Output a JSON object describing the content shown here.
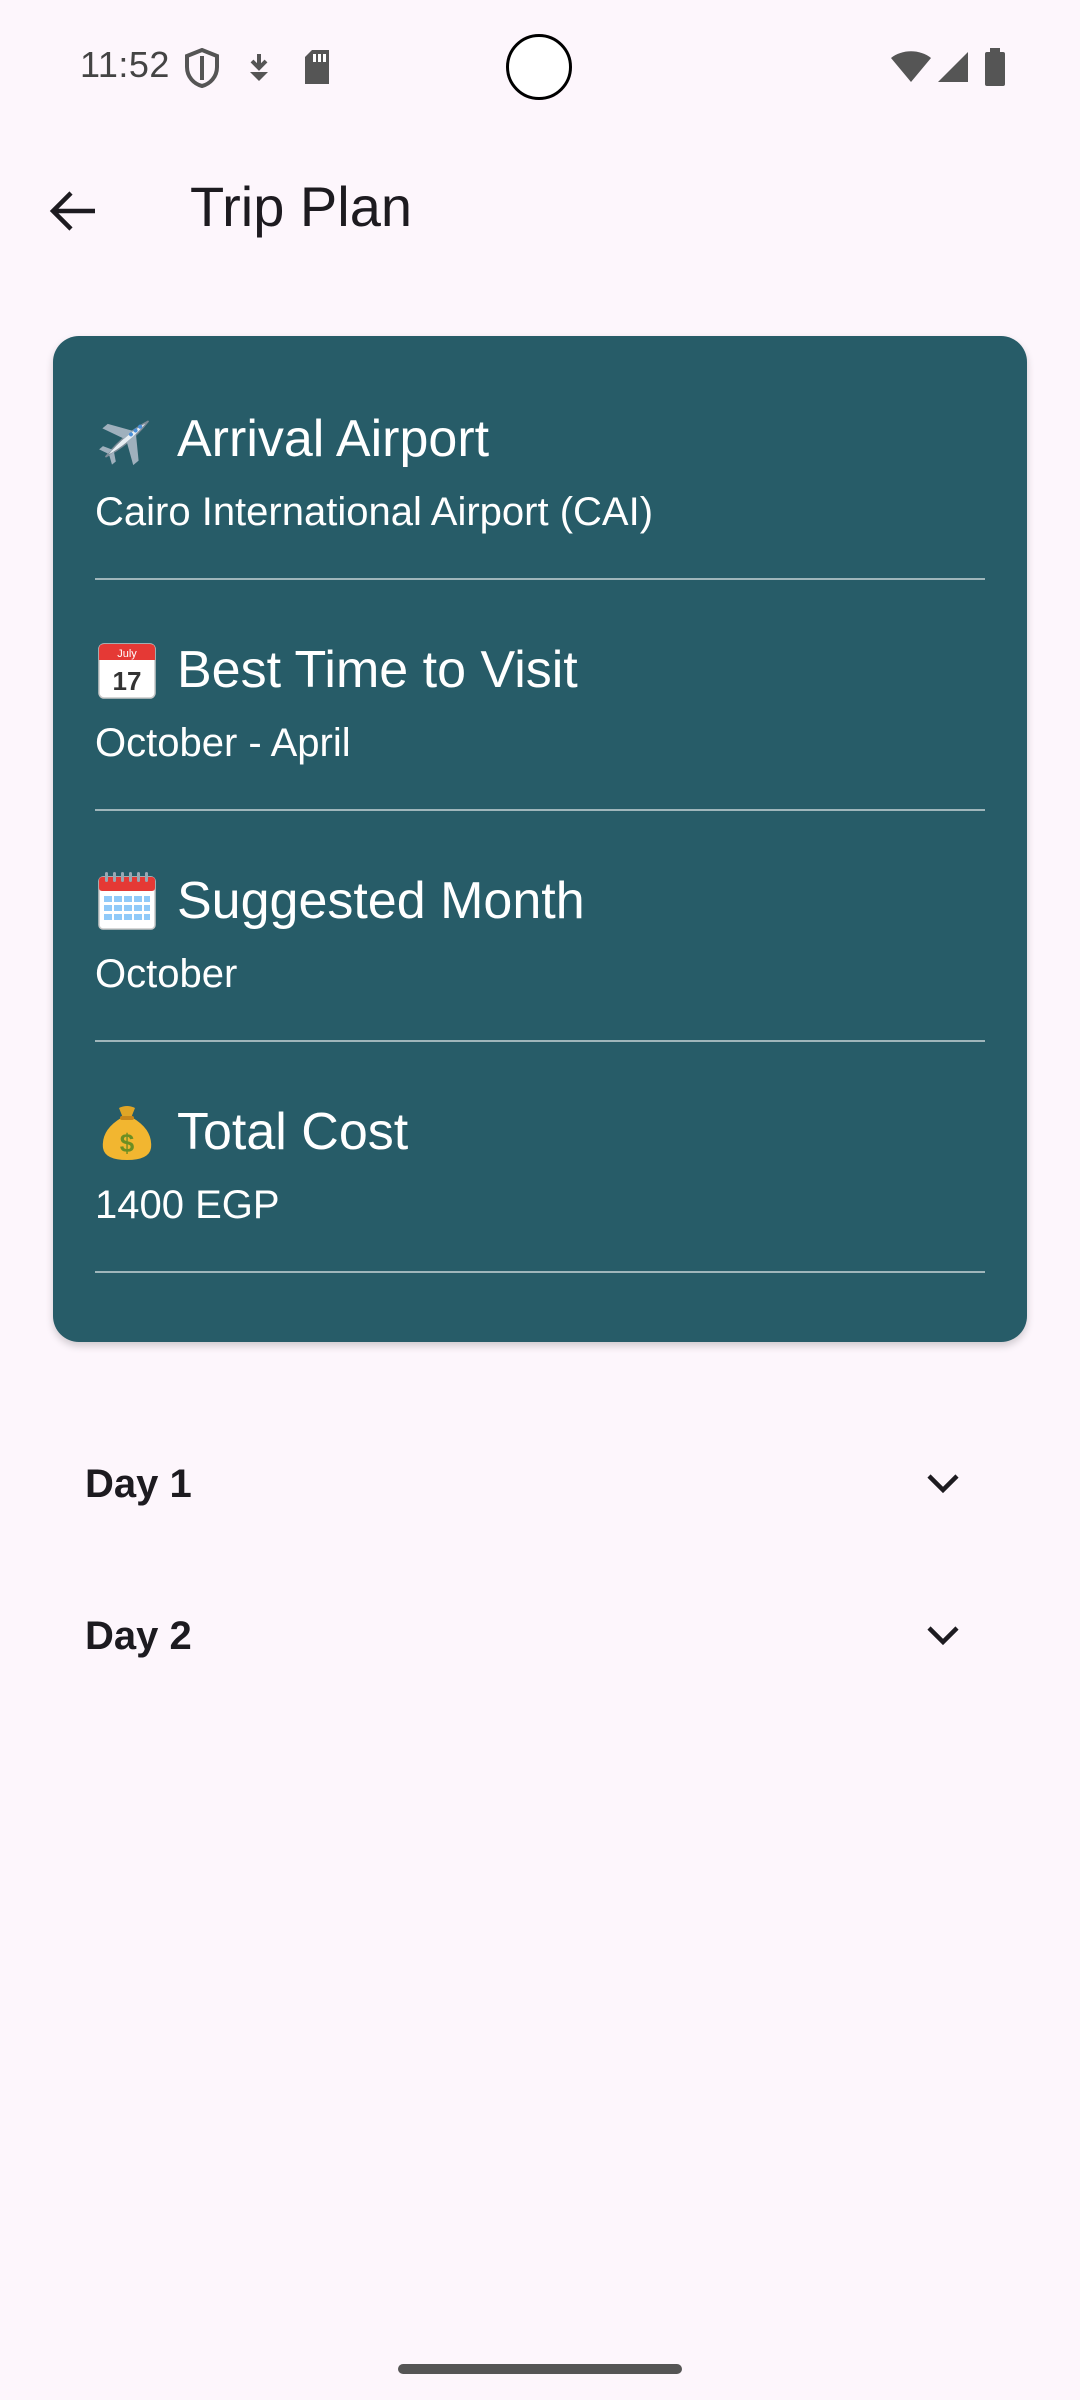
{
  "status_bar": {
    "time": "11:52",
    "icons": [
      "shield-icon",
      "download-status-icon",
      "sd-card-icon",
      "wifi-icon",
      "signal-icon",
      "battery-icon"
    ]
  },
  "app_bar": {
    "title": "Trip Plan",
    "back_icon": "arrow-back-icon"
  },
  "colors": {
    "background": "#fdf6fc",
    "card": "#275c68",
    "card_text": "#ffffff",
    "divider": "#9fb6bb"
  },
  "trip_info": [
    {
      "icon": "airplane-icon",
      "heading": "Arrival Airport",
      "value": "Cairo International Airport (CAI)"
    },
    {
      "icon": "calendar-icon",
      "calendar_month": "July",
      "calendar_day": "17",
      "heading": "Best Time to Visit",
      "value": "October - April"
    },
    {
      "icon": "spiral-calendar-icon",
      "heading": "Suggested Month",
      "value": "October"
    },
    {
      "icon": "money-bag-icon",
      "money_symbol": "$",
      "heading": "Total Cost",
      "value": "1400 EGP"
    }
  ],
  "days": [
    {
      "label": "Day 1",
      "icon": "chevron-down-icon"
    },
    {
      "label": "Day 2",
      "icon": "chevron-down-icon"
    }
  ]
}
